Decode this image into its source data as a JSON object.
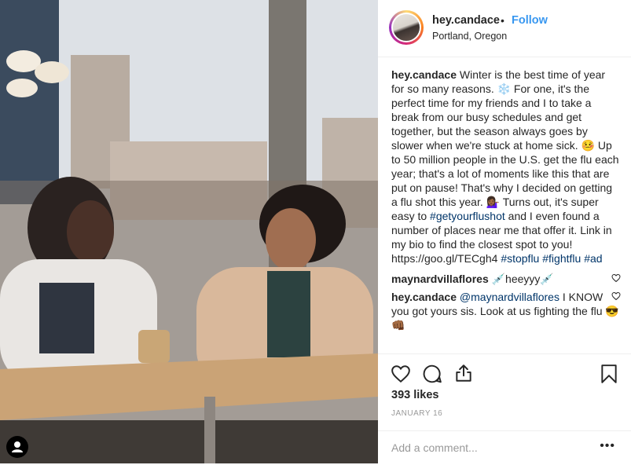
{
  "post": {
    "username": "hey.candace",
    "separator": "•",
    "follow_label": "Follow",
    "location": "Portland, Oregon"
  },
  "caption": {
    "username": "hey.candace",
    "text_1": "Winter is the best time of year for so many reasons. ❄️ For one, it's the perfect time for my friends and I to take a break from our busy schedules and get together, but the season always goes by slower when we're stuck at home sick. 🤒 Up to 50 million people in the U.S. get the flu each year; that's a lot of moments like this that are put on pause! That's why I decided on getting a flu shot this year. 💁🏾‍♀️ Turns out, it's super easy to ",
    "tag_1": "#getyourflushot",
    "text_2": " and I even found a number of places near me that offer it. Link in my bio to find the closest spot to you! https://goo.gl/TECgh4 ",
    "tag_2": "#stopflu",
    "tag_3": "#fightflu",
    "tag_4": "#ad"
  },
  "comments": [
    {
      "username": "maynardvillaflores",
      "text": "💉heeyyy💉"
    },
    {
      "username": "hey.candace",
      "mention": "@maynardvillaflores",
      "text": " I KNOW you got yours sis. Look at us fighting the flu 😎👊🏾"
    }
  ],
  "engagement": {
    "likes": "393 likes",
    "date": "JANUARY 16"
  },
  "composer": {
    "placeholder": "Add a comment...",
    "more": "•••"
  },
  "icons": {
    "like": "heart-icon",
    "comment": "comment-icon",
    "share": "share-icon",
    "save": "bookmark-icon",
    "more": "more-icon",
    "user_tags": "user-tag-icon"
  },
  "colors": {
    "link": "#3897f0",
    "hashtag": "#003569",
    "muted": "#999999"
  }
}
